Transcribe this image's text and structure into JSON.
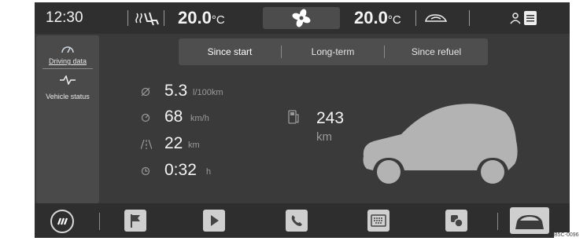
{
  "header": {
    "time": "12:30",
    "temp_left": "20.0",
    "temp_right": "20.0",
    "temp_unit": "°C",
    "seat_icon": "seat-heating-icon",
    "fan_icon": "fan-icon",
    "car_icon": "recirculation-icon",
    "status_icons": [
      "profile-icon",
      "menu-icon"
    ]
  },
  "sidebar": {
    "items": [
      {
        "label": "Driving data",
        "icon": "gauge-icon"
      },
      {
        "label": "Vehicle status",
        "icon": "pulse-icon"
      }
    ]
  },
  "tabs": [
    {
      "label": "Since start",
      "active": true
    },
    {
      "label": "Long-term",
      "active": false
    },
    {
      "label": "Since refuel",
      "active": false
    }
  ],
  "stats": [
    {
      "icon": "consumption-icon",
      "value": "5.3",
      "unit": "l/100km"
    },
    {
      "icon": "speed-icon",
      "value": "68",
      "unit": "km/h"
    },
    {
      "icon": "distance-icon",
      "value": "22",
      "unit": "km"
    },
    {
      "icon": "clock-icon",
      "value": "0:32",
      "unit": "h"
    }
  ],
  "range": {
    "icon": "fuel-pump-icon",
    "value": "243",
    "unit": "km"
  },
  "bottom_bar": {
    "items": [
      "home-icon",
      "flag-icon",
      "play-icon",
      "phone-icon",
      "keyboard-icon",
      "settings-icon",
      "car-icon"
    ]
  },
  "reference": "B5C-0096",
  "colors": {
    "screen_bg": "#3a3a3a",
    "bar_bg": "#2f2f2f",
    "text": "#f3f3f3",
    "muted": "#9a9a9a"
  }
}
